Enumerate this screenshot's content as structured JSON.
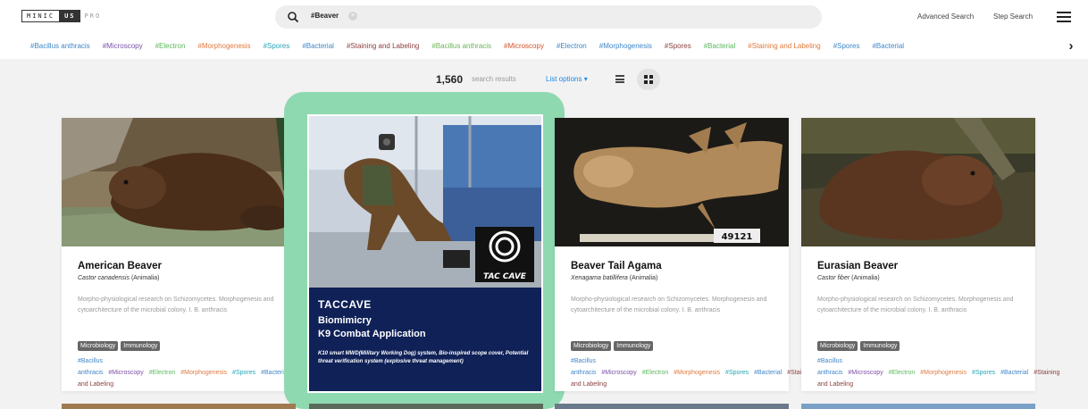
{
  "header": {
    "logo": {
      "part1": "MINIC",
      "part2": "US",
      "part3": "PRO"
    },
    "search_query": "#Beaver",
    "clear_glyph": "×",
    "advanced_search": "Advanced Search",
    "step_search": "Step Search"
  },
  "tagbar": {
    "tags": [
      {
        "label": "#Bacillus anthracis",
        "color": "#3f86c8"
      },
      {
        "label": "#Microscopy",
        "color": "#7b4fa8"
      },
      {
        "label": "#Electron",
        "color": "#5cb85c"
      },
      {
        "label": "#Morphogenesis",
        "color": "#e07a3f"
      },
      {
        "label": "#Spores",
        "color": "#26a6b5"
      },
      {
        "label": "#Bacterial",
        "color": "#3f86c8"
      },
      {
        "label": "#Staining and Labeling",
        "color": "#8b3f3f"
      },
      {
        "label": "#Bacillus anthracis",
        "color": "#6bb35a"
      },
      {
        "label": "#Microscopy",
        "color": "#d4532a"
      },
      {
        "label": "#Electron",
        "color": "#3f86c8"
      },
      {
        "label": "#Morphogenesis",
        "color": "#3f86c8"
      },
      {
        "label": "#Spores",
        "color": "#8b3f3f"
      },
      {
        "label": "#Bacterial",
        "color": "#5cb85c"
      },
      {
        "label": "#Staining and Labeling",
        "color": "#e07a3f"
      },
      {
        "label": "#Spores",
        "color": "#3f86c8"
      },
      {
        "label": "#Bacterial",
        "color": "#3f86c8"
      }
    ],
    "next_glyph": "›"
  },
  "results": {
    "count": "1,560",
    "label": "search results",
    "list_options": "List options ▾"
  },
  "cards": [
    {
      "title": "American Beaver",
      "sci": "Castor canadensis",
      "kingdom": "(Animalia)",
      "desc": "Morpho-physiological research on Schizomycetes. Morphogenesis and cytoarchitecture of the microbial colony. I. B. anthracis",
      "badges": [
        "Microbiology",
        "Immunology"
      ],
      "tags": [
        {
          "label": "#Bacillus anthracis",
          "color": "#3f86c8"
        },
        {
          "label": "#Microscopy",
          "color": "#7b4fa8"
        },
        {
          "label": "#Electron",
          "color": "#5cb85c"
        },
        {
          "label": "#Morphogenesis",
          "color": "#e07a3f"
        },
        {
          "label": "#Spores",
          "color": "#26a6b5"
        },
        {
          "label": "#Bacterial",
          "color": "#3f86c8"
        },
        {
          "label": "#Staining and Labeling",
          "color": "#8b3f3f"
        }
      ]
    },
    {
      "title": "Beaver Tail Agama",
      "sci": "Xenagama batillifera",
      "kingdom": "(Animalia)",
      "desc": "Morpho-physiological research on Schizomycetes. Morphogenesis and cytoarchitecture of the microbial colony. I. B. anthracis",
      "badges": [
        "Microbiology",
        "Immunology"
      ],
      "specimen": "49121",
      "tags": [
        {
          "label": "#Bacillus anthracis",
          "color": "#3f86c8"
        },
        {
          "label": "#Microscopy",
          "color": "#7b4fa8"
        },
        {
          "label": "#Electron",
          "color": "#5cb85c"
        },
        {
          "label": "#Morphogenesis",
          "color": "#e07a3f"
        },
        {
          "label": "#Spores",
          "color": "#26a6b5"
        },
        {
          "label": "#Bacterial",
          "color": "#3f86c8"
        },
        {
          "label": "#Staining and Labeling",
          "color": "#8b3f3f"
        }
      ]
    },
    {
      "title": "Eurasian Beaver",
      "sci": "Castor fiber",
      "kingdom": "(Animalia)",
      "desc": "Morpho-physiological research on Schizomycetes. Morphogenesis and cytoarchitecture of the microbial colony. I. B. anthracis",
      "badges": [
        "Microbiology",
        "Immunology"
      ],
      "tags": [
        {
          "label": "#Bacillus anthracis",
          "color": "#3f86c8"
        },
        {
          "label": "#Microscopy",
          "color": "#7b4fa8"
        },
        {
          "label": "#Electron",
          "color": "#5cb85c"
        },
        {
          "label": "#Morphogenesis",
          "color": "#e07a3f"
        },
        {
          "label": "#Spores",
          "color": "#26a6b5"
        },
        {
          "label": "#Bacterial",
          "color": "#3f86c8"
        },
        {
          "label": "#Staining and Labeling",
          "color": "#8b3f3f"
        }
      ]
    }
  ],
  "featured": {
    "logo_text": "TAC CAVE",
    "brand": "TACCAVE",
    "heading1": "Biomimicry",
    "heading2": "K9 Combat Application",
    "desc": "K10 smart MWD(Military Working Dog) system, Bio-inspired scope cover, Potential threat verification system (explosive threat management)",
    "accent": "#8fd9b0",
    "panel": "#0f2157"
  }
}
